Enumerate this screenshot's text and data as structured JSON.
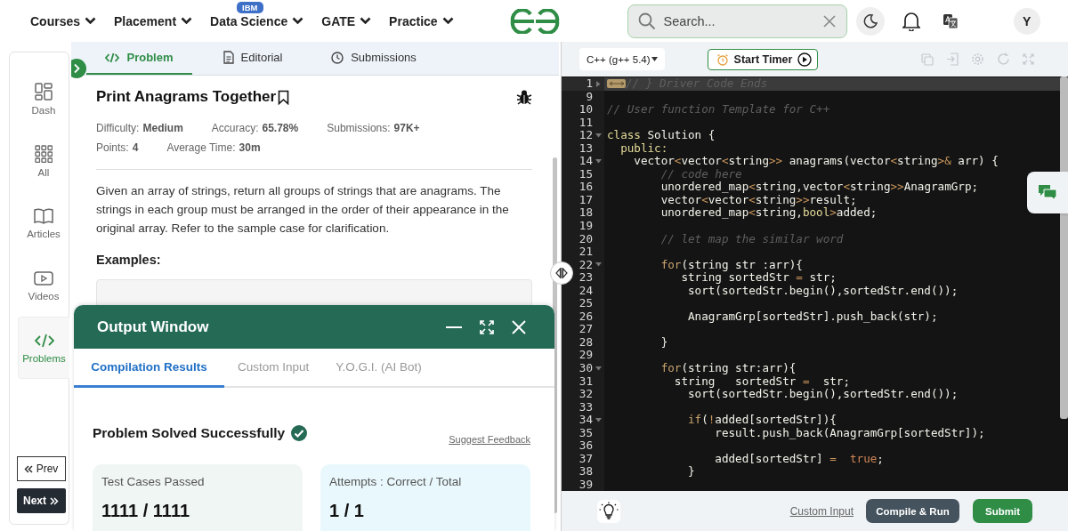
{
  "nav": {
    "items": [
      {
        "label": "Courses"
      },
      {
        "label": "Placement"
      },
      {
        "label": "Data Science",
        "badge": "IBM"
      },
      {
        "label": "GATE"
      },
      {
        "label": "Practice"
      }
    ]
  },
  "search": {
    "placeholder": "Search..."
  },
  "avatar": {
    "initial": "Y"
  },
  "sidebar": {
    "items": [
      {
        "label": "Dash",
        "kind": "dash",
        "selected": false
      },
      {
        "label": "All",
        "kind": "all",
        "selected": false
      },
      {
        "label": "Articles",
        "kind": "articles",
        "selected": false
      },
      {
        "label": "Videos",
        "kind": "videos",
        "selected": false
      },
      {
        "label": "Problems",
        "kind": "problems",
        "selected": true
      }
    ],
    "prev": "Prev",
    "next": "Next"
  },
  "problem_tabs": [
    {
      "label": "Problem",
      "kind": "code",
      "selected": true
    },
    {
      "label": "Editorial",
      "kind": "doc",
      "selected": false
    },
    {
      "label": "Submissions",
      "kind": "clock",
      "selected": false
    }
  ],
  "problem": {
    "title": "Print Anagrams Together",
    "stats": [
      {
        "label": "Difficulty:",
        "value": "Medium"
      },
      {
        "label": "Accuracy:",
        "value": "65.78%"
      },
      {
        "label": "Submissions:",
        "value": "97K+"
      },
      {
        "label": "Points:",
        "value": "4"
      },
      {
        "label": "Average Time:",
        "value": "30m"
      }
    ],
    "description": "Given an array of strings, return all groups of strings that are anagrams. The strings in each group must be arranged in the order of their appearance in the original array. Refer to the sample case for clarification.",
    "examples_heading": "Examples:"
  },
  "output_window": {
    "title": "Output Window",
    "tabs": [
      {
        "label": "Compilation Results",
        "selected": true
      },
      {
        "label": "Custom Input",
        "selected": false
      },
      {
        "label": "Y.O.G.I. (AI Bot)",
        "selected": false
      }
    ],
    "status": "Problem Solved Successfully",
    "feedback_link": "Suggest Feedback",
    "cards": [
      {
        "label": "Test Cases Passed",
        "value": "1111 / 1111",
        "kind": "tests"
      },
      {
        "label": "Attempts : Correct / Total",
        "value": "1 / 1",
        "kind": "attempts"
      }
    ]
  },
  "editor": {
    "language": "C++ (g++ 5.4)",
    "timer_button": "Start Timer",
    "lines": [
      {
        "number": "1",
        "kind": "folded",
        "active": true,
        "tokens": [
          {
            "t": "// } Driver Code Ends",
            "kind": "comment"
          }
        ]
      },
      {
        "number": "9",
        "kind": "plain",
        "active": false
      },
      {
        "number": "10",
        "kind": "plain",
        "active": false,
        "tokens": [
          {
            "t": "// User function Template for C++",
            "kind": "comment"
          }
        ]
      },
      {
        "number": "11",
        "kind": "plain",
        "active": false
      },
      {
        "number": "12",
        "kind": "foldable",
        "active": false,
        "tokens": [
          {
            "t": "class",
            "kind": "keyword"
          },
          {
            "t": " Solution {",
            "kind": "plain"
          }
        ]
      },
      {
        "number": "13",
        "kind": "plain",
        "active": false,
        "tokens": [
          {
            "t": "  public:",
            "kind": "keyword"
          }
        ]
      },
      {
        "number": "14",
        "kind": "foldable",
        "active": false,
        "tokens": [
          {
            "t": "    vector",
            "kind": "plain"
          },
          {
            "t": "<",
            "kind": "op"
          },
          {
            "t": "vector",
            "kind": "plain"
          },
          {
            "t": "<",
            "kind": "op"
          },
          {
            "t": "string",
            "kind": "plain"
          },
          {
            "t": ">>",
            "kind": "op"
          },
          {
            "t": " anagrams(vector",
            "kind": "plain"
          },
          {
            "t": "<",
            "kind": "op"
          },
          {
            "t": "string",
            "kind": "plain"
          },
          {
            "t": ">&",
            "kind": "op"
          },
          {
            "t": " arr) {",
            "kind": "plain"
          }
        ]
      },
      {
        "number": "15",
        "kind": "plain",
        "active": false,
        "tokens": [
          {
            "t": "        // code here",
            "kind": "comment"
          }
        ]
      },
      {
        "number": "16",
        "kind": "plain",
        "active": false,
        "tokens": [
          {
            "t": "        unordered_map",
            "kind": "plain"
          },
          {
            "t": "<",
            "kind": "op"
          },
          {
            "t": "string,vector",
            "kind": "plain"
          },
          {
            "t": "<",
            "kind": "op"
          },
          {
            "t": "string",
            "kind": "plain"
          },
          {
            "t": ">>",
            "kind": "op"
          },
          {
            "t": "AnagramGrp;",
            "kind": "plain"
          }
        ]
      },
      {
        "number": "17",
        "kind": "plain",
        "active": false,
        "tokens": [
          {
            "t": "        vector",
            "kind": "plain"
          },
          {
            "t": "<",
            "kind": "op"
          },
          {
            "t": "vector",
            "kind": "plain"
          },
          {
            "t": "<",
            "kind": "op"
          },
          {
            "t": "string",
            "kind": "plain"
          },
          {
            "t": ">>",
            "kind": "op"
          },
          {
            "t": "result;",
            "kind": "plain"
          }
        ]
      },
      {
        "number": "18",
        "kind": "plain",
        "active": false,
        "tokens": [
          {
            "t": "        unordered_map",
            "kind": "plain"
          },
          {
            "t": "<",
            "kind": "op"
          },
          {
            "t": "string,",
            "kind": "plain"
          },
          {
            "t": "bool",
            "kind": "keyword"
          },
          {
            "t": ">",
            "kind": "op"
          },
          {
            "t": "added;",
            "kind": "plain"
          }
        ]
      },
      {
        "number": "19",
        "kind": "plain",
        "active": false
      },
      {
        "number": "20",
        "kind": "plain",
        "active": false,
        "tokens": [
          {
            "t": "        // let map the similar word",
            "kind": "comment"
          }
        ]
      },
      {
        "number": "21",
        "kind": "plain",
        "active": false
      },
      {
        "number": "22",
        "kind": "foldable",
        "active": false,
        "tokens": [
          {
            "t": "        for",
            "kind": "control"
          },
          {
            "t": "(string str :arr){",
            "kind": "plain"
          }
        ]
      },
      {
        "number": "23",
        "kind": "plain",
        "active": false,
        "tokens": [
          {
            "t": "           string sortedStr ",
            "kind": "plain"
          },
          {
            "t": "=",
            "kind": "op"
          },
          {
            "t": " str;",
            "kind": "plain"
          }
        ]
      },
      {
        "number": "24",
        "kind": "plain",
        "active": false,
        "tokens": [
          {
            "t": "            sort(sortedStr.begin(),sortedStr.end());",
            "kind": "plain"
          }
        ]
      },
      {
        "number": "25",
        "kind": "plain",
        "active": false
      },
      {
        "number": "26",
        "kind": "plain",
        "active": false,
        "tokens": [
          {
            "t": "            AnagramGrp[sortedStr].push_back(str);",
            "kind": "plain"
          }
        ]
      },
      {
        "number": "27",
        "kind": "plain",
        "active": false
      },
      {
        "number": "28",
        "kind": "plain",
        "active": false,
        "tokens": [
          {
            "t": "        }",
            "kind": "plain"
          }
        ]
      },
      {
        "number": "29",
        "kind": "plain",
        "active": false
      },
      {
        "number": "30",
        "kind": "foldable",
        "active": false,
        "tokens": [
          {
            "t": "        for",
            "kind": "control"
          },
          {
            "t": "(string str:arr){",
            "kind": "plain"
          }
        ]
      },
      {
        "number": "31",
        "kind": "plain",
        "active": false,
        "tokens": [
          {
            "t": "          string   sortedStr ",
            "kind": "plain"
          },
          {
            "t": "=",
            "kind": "op"
          },
          {
            "t": "  str;",
            "kind": "plain"
          }
        ]
      },
      {
        "number": "32",
        "kind": "plain",
        "active": false,
        "tokens": [
          {
            "t": "            sort(sortedStr.begin(),sortedStr.end());",
            "kind": "plain"
          }
        ]
      },
      {
        "number": "33",
        "kind": "plain",
        "active": false
      },
      {
        "number": "34",
        "kind": "foldable",
        "active": false,
        "tokens": [
          {
            "t": "            if",
            "kind": "control"
          },
          {
            "t": "(",
            "kind": "plain"
          },
          {
            "t": "!",
            "kind": "op"
          },
          {
            "t": "added[sortedStr]){",
            "kind": "plain"
          }
        ]
      },
      {
        "number": "35",
        "kind": "plain",
        "active": false,
        "tokens": [
          {
            "t": "                result.push_back(AnagramGrp[sortedStr]);",
            "kind": "plain"
          }
        ]
      },
      {
        "number": "36",
        "kind": "plain",
        "active": false
      },
      {
        "number": "37",
        "kind": "plain",
        "active": false,
        "tokens": [
          {
            "t": "                added[sortedStr] ",
            "kind": "plain"
          },
          {
            "t": "=",
            "kind": "op"
          },
          {
            "t": "  true",
            "kind": "literal"
          },
          {
            "t": ";",
            "kind": "plain"
          }
        ]
      },
      {
        "number": "38",
        "kind": "plain",
        "active": false,
        "tokens": [
          {
            "t": "            }",
            "kind": "plain"
          }
        ]
      },
      {
        "number": "39",
        "kind": "plain",
        "active": false
      }
    ],
    "custom_input_link": "Custom Input",
    "compile_button": "Compile & Run",
    "submit_button": "Submit"
  }
}
